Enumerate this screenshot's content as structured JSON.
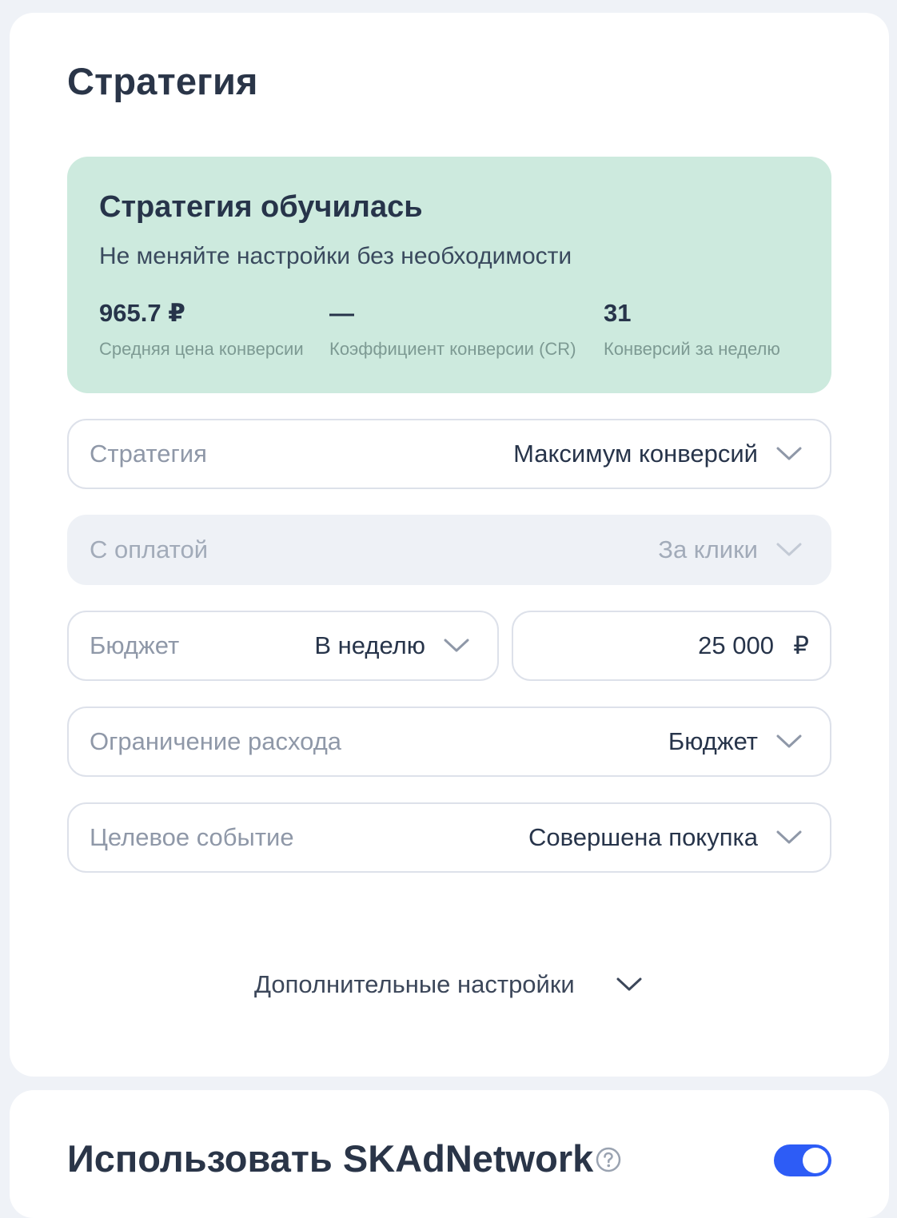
{
  "strategy_section": {
    "title": "Стратегия",
    "status": {
      "title": "Стратегия обучилась",
      "subtitle": "Не меняйте настройки без необходимости",
      "metrics": [
        {
          "value": "965.7 ₽",
          "label": "Средняя цена конверсии"
        },
        {
          "value": "—",
          "label": "Коэффициент конверсии (CR)"
        },
        {
          "value": "31",
          "label": "Конверсий за неделю"
        }
      ]
    },
    "fields": {
      "strategy": {
        "label": "Стратегия",
        "value": "Максимум конверсий"
      },
      "payment": {
        "label": "С оплатой",
        "value": "За клики"
      },
      "budget": {
        "label": "Бюджет",
        "value": "В неделю"
      },
      "amount": {
        "value": "25 000",
        "currency": "₽"
      },
      "spend_limit": {
        "label": "Ограничение расхода",
        "value": "Бюджет"
      },
      "target_event": {
        "label": "Целевое событие",
        "value": "Совершена покупка"
      }
    },
    "advanced_settings_label": "Дополнительные настройки"
  },
  "skadnetwork_section": {
    "title": "Использовать SKAdNetwork",
    "toggle_on": true
  },
  "colors": {
    "accent": "#2d5cf6",
    "status_bg": "#cdeade",
    "page_bg": "#eff2f7"
  },
  "icons": {
    "dropdown": "chevron-down-icon",
    "help": "question-circle-icon"
  }
}
